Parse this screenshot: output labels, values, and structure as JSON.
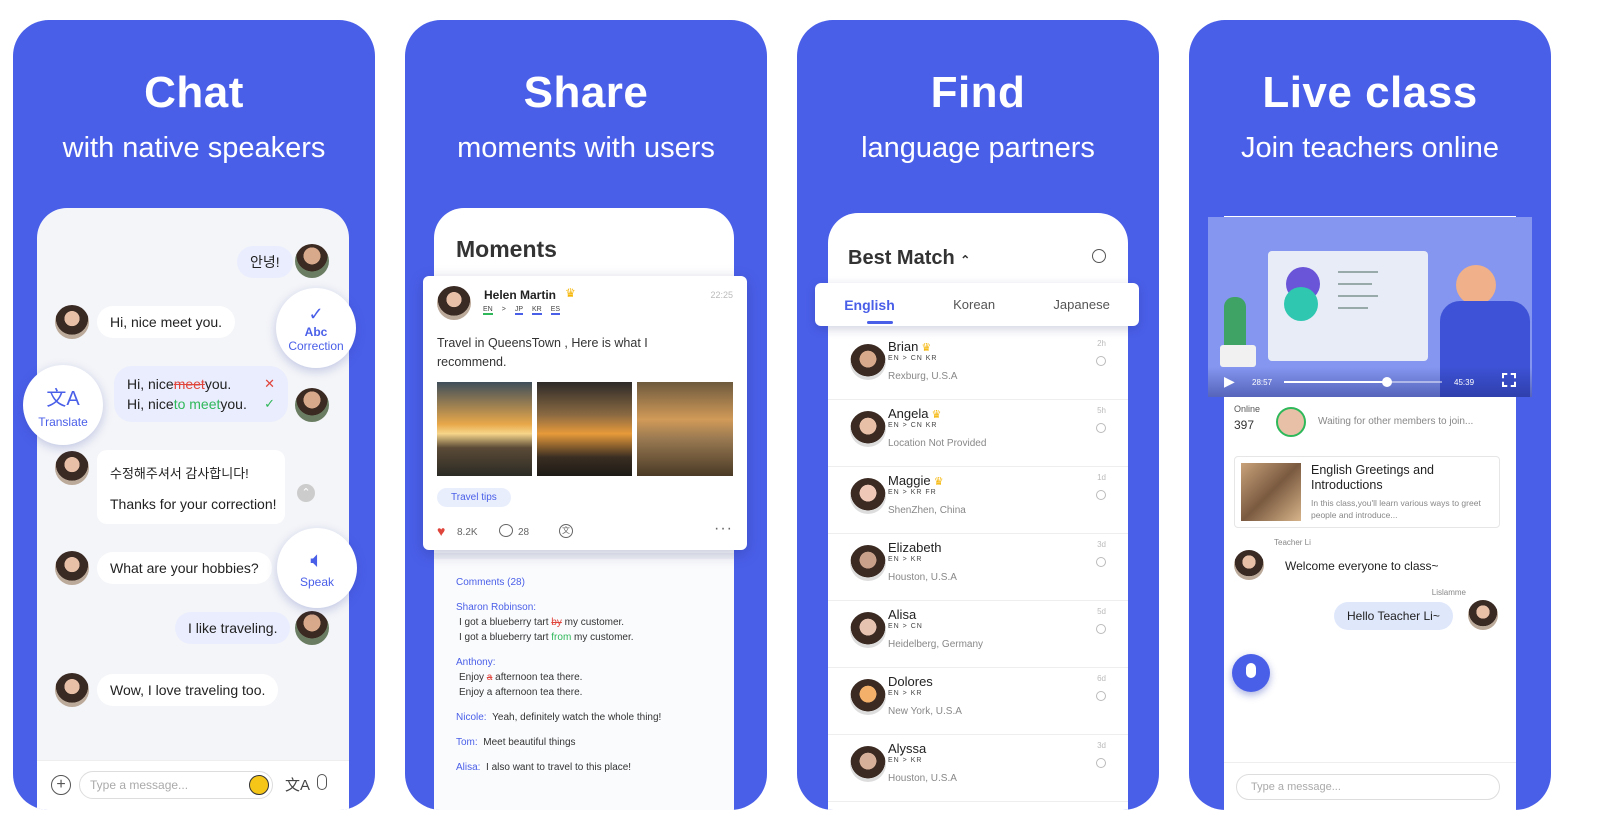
{
  "panels": {
    "chat": {
      "title": "Chat",
      "subtitle": "with native speakers"
    },
    "share": {
      "title": "Share",
      "subtitle": "moments with users"
    },
    "find": {
      "title": "Find",
      "subtitle": "language partners"
    },
    "live": {
      "title": "Live class",
      "subtitle": "Join teachers online"
    }
  },
  "chat": {
    "msg1": "안녕!",
    "msg2": "Hi, nice meet you.",
    "corr_wrong_pre": "Hi, nice ",
    "corr_wrong_word": "meet",
    "corr_wrong_post": " you.",
    "corr_right_pre": "Hi, nice ",
    "corr_right_word": "to meet",
    "corr_right_post": " you.",
    "msg4_line1": "수정해주셔서 감사합니다!",
    "msg4_line2": "Thanks for your correction!",
    "msg5": "What are your hobbies?",
    "msg6": "I like traveling.",
    "msg7": "Wow, I love traveling too.",
    "correction_abc": "Abc",
    "correction_label": "Correction",
    "translate_label": "Translate",
    "speak_label": "Speak",
    "input_placeholder": "Type a message..."
  },
  "moments": {
    "header": "Moments",
    "author": "Helen Martin",
    "time": "22:25",
    "langs": [
      "EN",
      ">",
      "JP",
      "KR",
      "ES"
    ],
    "text": "Travel in QueensTown , Here is what I recommend.",
    "tag": "Travel tips",
    "likes": "8.2K",
    "comments_count": "28",
    "comments_title": "Comments (28)",
    "c1_name": "Sharon Robinson:",
    "c1_l1_pre": "I got a blueberry tart ",
    "c1_l1_wrong": "by",
    "c1_l1_post": " my customer.",
    "c1_l2_pre": "I got a blueberry tart ",
    "c1_l2_right": "from",
    "c1_l2_post": " my customer.",
    "c2_name": "Anthony:",
    "c2_l1_pre": "Enjoy ",
    "c2_l1_wrong": "a",
    "c2_l1_post": " afternoon tea there.",
    "c2_l2": "Enjoy a afternoon tea there.",
    "c3_name": "Nicole:",
    "c3_text": "Yeah, definitely watch the whole thing!",
    "c4_name": "Tom:",
    "c4_text": "Meet beautiful things",
    "c5_name": "Alisa:",
    "c5_text": "I also want to travel to this place!"
  },
  "find": {
    "header": "Best Match",
    "tabs": [
      "English",
      "Korean",
      "Japanese"
    ],
    "people": [
      {
        "name": "Brian",
        "langs": "EN  >  CN  KR",
        "loc": "Rexburg,  U.S.A",
        "time": "2h",
        "crown": true
      },
      {
        "name": "Angela",
        "langs": "EN  >  CN  KR",
        "loc": "Location Not Provided",
        "time": "5h",
        "crown": true
      },
      {
        "name": "Maggie",
        "langs": "EN  >  KR  FR",
        "loc": "ShenZhen,  China",
        "time": "1d",
        "crown": true
      },
      {
        "name": "Elizabeth",
        "langs": "EN  >  KR",
        "loc": "Houston,  U.S.A",
        "time": "3d",
        "crown": false
      },
      {
        "name": "Alisa",
        "langs": "EN  >  CN",
        "loc": "Heidelberg,  Germany",
        "time": "5d",
        "crown": false
      },
      {
        "name": "Dolores",
        "langs": "EN  >  KR",
        "loc": "New York,  U.S.A",
        "time": "6d",
        "crown": false
      },
      {
        "name": "Alyssa",
        "langs": "EN  >  KR",
        "loc": "Houston,  U.S.A",
        "time": "3d",
        "crown": false
      }
    ]
  },
  "live": {
    "time_current": "28:57",
    "time_total": "45:39",
    "progress": 0.65,
    "online_label": "Online",
    "online_count": "397",
    "waiting": "Waiting for other members to join...",
    "class_title": "English Greetings and Introductions",
    "class_desc": "In this class,you'll learn various ways to greet people and introduce...",
    "teacher_name": "Teacher Li",
    "teacher_msg": "Welcome everyone to class~",
    "student_name": "Lislamme",
    "student_msg": "Hello Teacher Li~",
    "input_placeholder": "Type a message..."
  },
  "colors": {
    "brand": "#4a5fe8",
    "green": "#2fb85a",
    "red": "#e0453c",
    "gold": "#f5b400"
  }
}
